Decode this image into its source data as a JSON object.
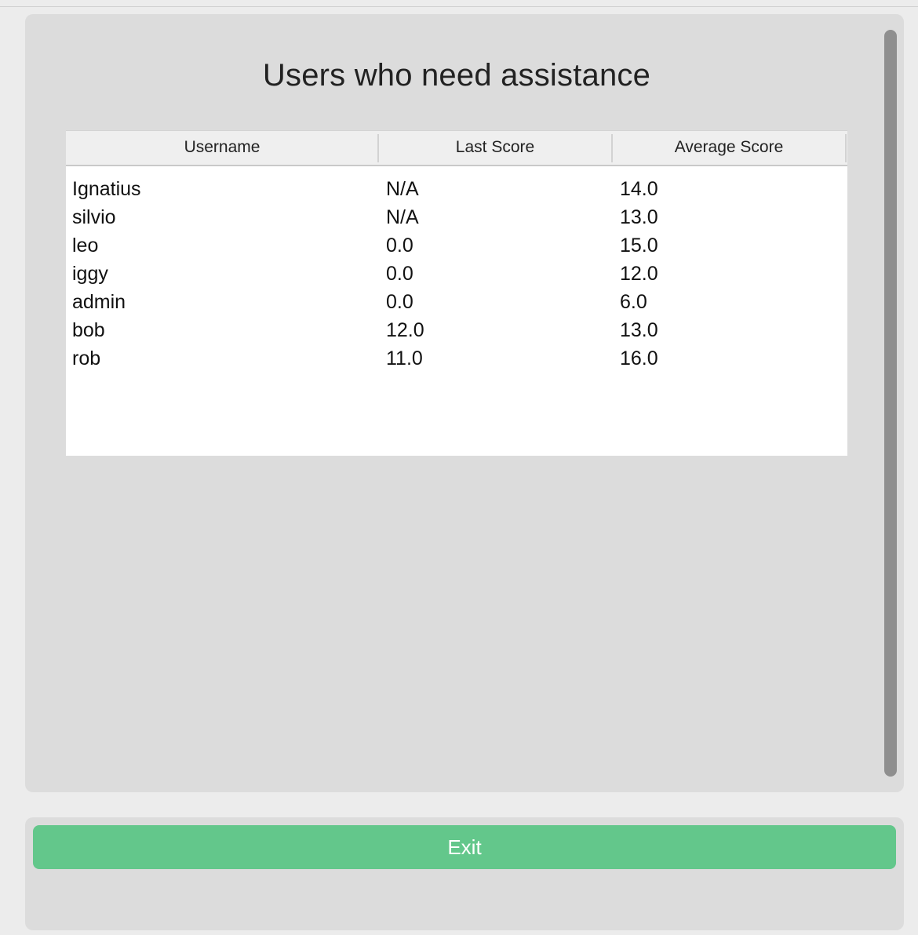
{
  "title": "Users who need assistance",
  "table": {
    "columns": [
      "Username",
      "Last Score",
      "Average Score"
    ],
    "rows": [
      [
        "Ignatius",
        "N/A",
        "14.0"
      ],
      [
        "silvio",
        "N/A",
        "13.0"
      ],
      [
        "leo",
        "0.0",
        "15.0"
      ],
      [
        "iggy",
        "0.0",
        "12.0"
      ],
      [
        "admin",
        "0.0",
        "6.0"
      ],
      [
        "bob",
        "12.0",
        "13.0"
      ],
      [
        "rob",
        "11.0",
        "16.0"
      ]
    ]
  },
  "footer": {
    "exit_label": "Exit"
  },
  "colors": {
    "accent": "#63c78b",
    "panel": "#dcdcdc",
    "background": "#ececec"
  }
}
